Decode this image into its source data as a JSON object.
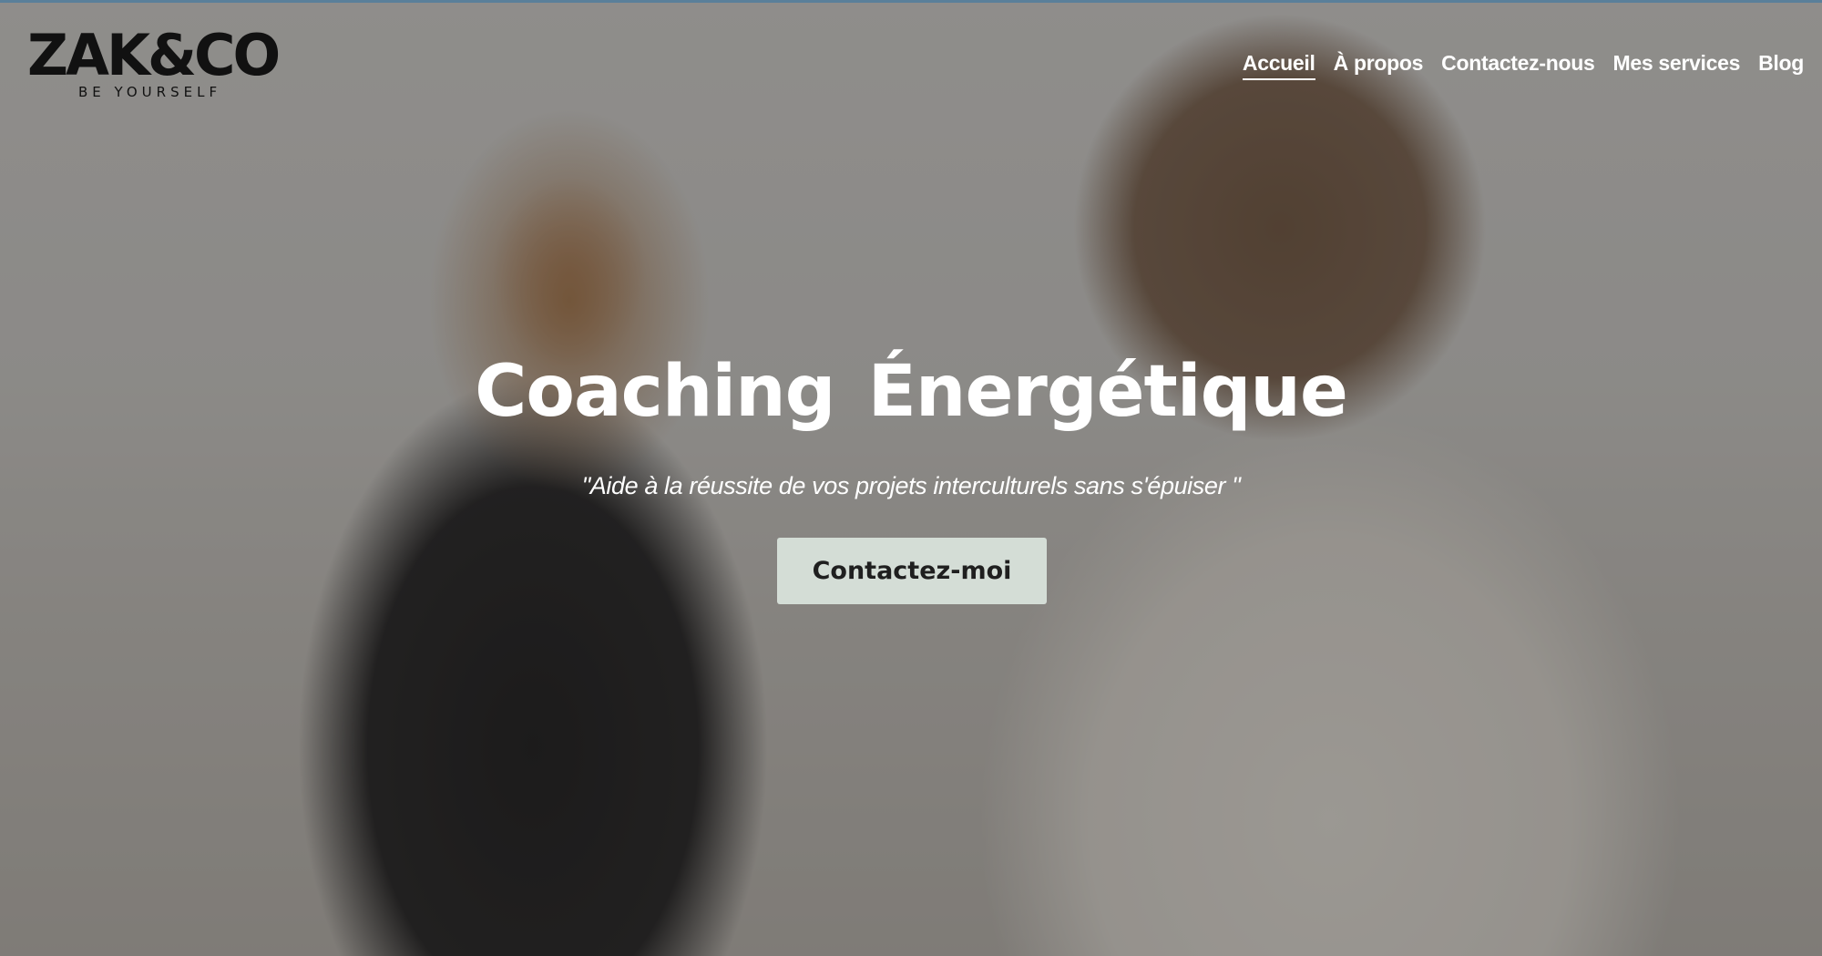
{
  "brand": {
    "logo_text": "ZAK&CO",
    "tagline": "BE YOURSELF"
  },
  "nav": {
    "items": [
      {
        "label": "Accueil",
        "active": true
      },
      {
        "label": "À propos"
      },
      {
        "label": "Contactez-nous"
      },
      {
        "label": "Mes services"
      },
      {
        "label": "Blog"
      }
    ]
  },
  "hero": {
    "title": "Coaching  Énergétique",
    "subtitle": "\"Aide à la réussite de vos projets interculturels sans s'épuiser \"",
    "cta_label": "Contactez-moi"
  },
  "colors": {
    "cta_background": "#d4ddd6",
    "text_light": "#ffffff",
    "logo": "#111111"
  }
}
